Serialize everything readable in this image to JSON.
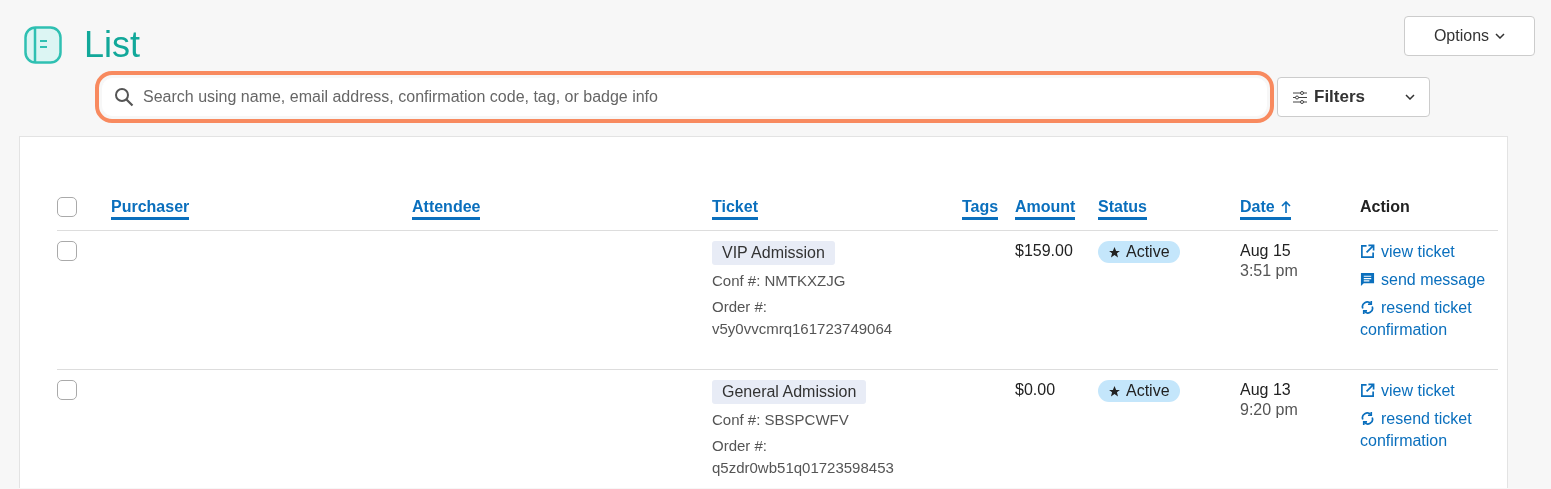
{
  "header": {
    "title": "List"
  },
  "options_button": {
    "label": "Options"
  },
  "search": {
    "placeholder": "Search using name, email address, confirmation code, tag, or badge info",
    "focused": true
  },
  "filters_button": {
    "label": "Filters"
  },
  "table": {
    "select_all": {
      "checked": false
    },
    "columns": [
      {
        "label": "Purchaser",
        "sortable": true,
        "sorted": false
      },
      {
        "label": "Attendee",
        "sortable": true,
        "sorted": false
      },
      {
        "label": "Ticket",
        "sortable": true,
        "sorted": false
      },
      {
        "label": "Tags",
        "sortable": true,
        "sorted": false
      },
      {
        "label": "Amount",
        "sortable": true,
        "sorted": false
      },
      {
        "label": "Status",
        "sortable": true,
        "sorted": false
      },
      {
        "label": "Date",
        "sortable": true,
        "sorted": true
      },
      {
        "label": "Action",
        "sortable": false,
        "sorted": false
      }
    ],
    "rows": [
      {
        "checked": false,
        "ticket": "VIP Admission",
        "conf": "Conf #: NMTKXZJG",
        "order_label": "Order #:",
        "order": "v5y0vvcmrq161723749064",
        "amount": "$159.00",
        "status": "Active",
        "date": "Aug 15",
        "time": "3:51 pm",
        "actions": [
          {
            "kind": "view",
            "label": "view ticket"
          },
          {
            "kind": "message",
            "label": "send message"
          },
          {
            "kind": "resend",
            "label": "resend ticket confirmation"
          }
        ]
      },
      {
        "checked": false,
        "ticket": "General Admission",
        "conf": "Conf #: SBSPCWFV",
        "order_label": "Order #:",
        "order": "q5zdr0wb51q01723598453",
        "amount": "$0.00",
        "status": "Active",
        "date": "Aug 13",
        "time": "9:20 pm",
        "actions": [
          {
            "kind": "view",
            "label": "view ticket"
          },
          {
            "kind": "resend",
            "label": "resend ticket confirmation"
          }
        ]
      }
    ]
  }
}
